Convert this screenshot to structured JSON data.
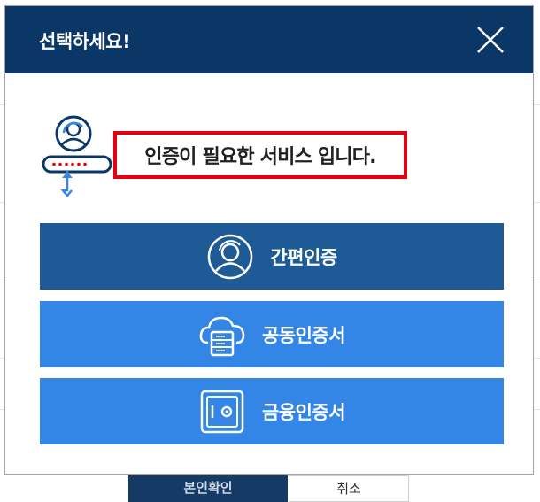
{
  "dialog": {
    "title": "선택하세요!",
    "notice": "인증이 필요한 서비스 입니다."
  },
  "buttons": [
    {
      "label": "간편인증",
      "icon": "user-circle-icon",
      "color": "#1e5a96"
    },
    {
      "label": "공동인증서",
      "icon": "cloud-server-icon",
      "color": "#3385e6"
    },
    {
      "label": "금융인증서",
      "icon": "safe-icon",
      "color": "#3385e6"
    }
  ],
  "background": {
    "left_button": "본인확인",
    "right_button": "취소"
  },
  "colors": {
    "header": "#0b3766",
    "notice_border": "#e60012"
  }
}
